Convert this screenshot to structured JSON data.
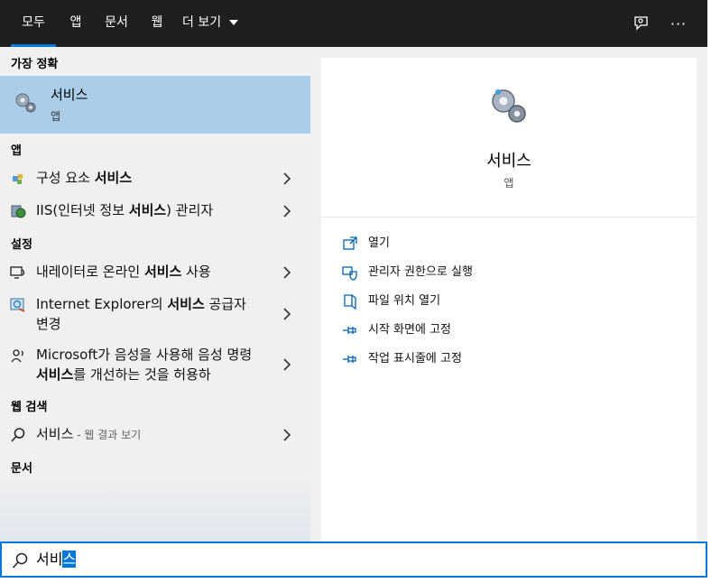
{
  "tabs": [
    {
      "label": "모두",
      "active": true
    },
    {
      "label": "앱"
    },
    {
      "label": "문서"
    },
    {
      "label": "웹"
    },
    {
      "label": "더 보기"
    }
  ],
  "toolbar": {
    "feedback_icon": "feedback-icon",
    "more_label": "···"
  },
  "sections": {
    "best": "가장 정확",
    "apps": "앱",
    "settings": "설정",
    "web": "웹 검색",
    "docs": "문서"
  },
  "best_match": {
    "title": "서비스",
    "subtitle": "앱"
  },
  "apps": [
    {
      "pre": "구성 요소 ",
      "bold": "서비스",
      "post": ""
    },
    {
      "pre": "IIS(인터넷 정보 ",
      "bold": "서비스",
      "post": ") 관리자"
    }
  ],
  "settings": [
    {
      "pre": "내레이터로 온라인 ",
      "bold": "서비스",
      "post": " 사용"
    },
    {
      "pre": "Internet Explorer의 ",
      "bold": "서비스",
      "post": " 공급자 변경"
    },
    {
      "pre": "Microsoft가 음성을 사용해 음성 명령 ",
      "bold": "서비스",
      "post": "를 개선하는 것을 허용하"
    }
  ],
  "web": {
    "query": "서비스",
    "suffix": " - 웹 결과 보기"
  },
  "preview": {
    "title": "서비스",
    "subtitle": "앱"
  },
  "actions": [
    {
      "label": "열기",
      "icon": "open-icon"
    },
    {
      "label": "관리자 권한으로 실행",
      "icon": "shield-icon"
    },
    {
      "label": "파일 위치 열기",
      "icon": "file-location-icon"
    },
    {
      "label": "시작 화면에 고정",
      "icon": "pin-icon"
    },
    {
      "label": "작업 표시줄에 고정",
      "icon": "pin-icon"
    }
  ],
  "search": {
    "text_before": "서비",
    "text_selected": "스"
  },
  "colors": {
    "accent": "#0078d7",
    "highlight": "#a9cce8",
    "topbar": "#1f1f1f"
  }
}
